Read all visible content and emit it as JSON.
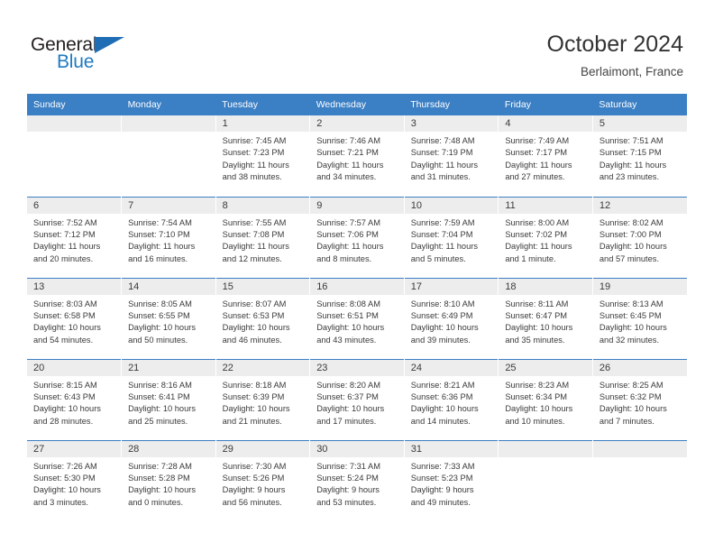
{
  "brand": {
    "name_part1": "General",
    "name_part2": "Blue",
    "triangle_color": "#1f6db5",
    "blue_color": "#1f7ac0"
  },
  "header": {
    "title": "October 2024",
    "location": "Berlaimont, France"
  },
  "theme": {
    "header_blue": "#3b7fc4",
    "daynum_gray": "#ededed",
    "text_color": "#3a3a3a"
  },
  "weekdays": [
    "Sunday",
    "Monday",
    "Tuesday",
    "Wednesday",
    "Thursday",
    "Friday",
    "Saturday"
  ],
  "weeks": [
    [
      {
        "day": "",
        "lines": []
      },
      {
        "day": "",
        "lines": []
      },
      {
        "day": "1",
        "lines": [
          "Sunrise: 7:45 AM",
          "Sunset: 7:23 PM",
          "Daylight: 11 hours",
          "and 38 minutes."
        ]
      },
      {
        "day": "2",
        "lines": [
          "Sunrise: 7:46 AM",
          "Sunset: 7:21 PM",
          "Daylight: 11 hours",
          "and 34 minutes."
        ]
      },
      {
        "day": "3",
        "lines": [
          "Sunrise: 7:48 AM",
          "Sunset: 7:19 PM",
          "Daylight: 11 hours",
          "and 31 minutes."
        ]
      },
      {
        "day": "4",
        "lines": [
          "Sunrise: 7:49 AM",
          "Sunset: 7:17 PM",
          "Daylight: 11 hours",
          "and 27 minutes."
        ]
      },
      {
        "day": "5",
        "lines": [
          "Sunrise: 7:51 AM",
          "Sunset: 7:15 PM",
          "Daylight: 11 hours",
          "and 23 minutes."
        ]
      }
    ],
    [
      {
        "day": "6",
        "lines": [
          "Sunrise: 7:52 AM",
          "Sunset: 7:12 PM",
          "Daylight: 11 hours",
          "and 20 minutes."
        ]
      },
      {
        "day": "7",
        "lines": [
          "Sunrise: 7:54 AM",
          "Sunset: 7:10 PM",
          "Daylight: 11 hours",
          "and 16 minutes."
        ]
      },
      {
        "day": "8",
        "lines": [
          "Sunrise: 7:55 AM",
          "Sunset: 7:08 PM",
          "Daylight: 11 hours",
          "and 12 minutes."
        ]
      },
      {
        "day": "9",
        "lines": [
          "Sunrise: 7:57 AM",
          "Sunset: 7:06 PM",
          "Daylight: 11 hours",
          "and 8 minutes."
        ]
      },
      {
        "day": "10",
        "lines": [
          "Sunrise: 7:59 AM",
          "Sunset: 7:04 PM",
          "Daylight: 11 hours",
          "and 5 minutes."
        ]
      },
      {
        "day": "11",
        "lines": [
          "Sunrise: 8:00 AM",
          "Sunset: 7:02 PM",
          "Daylight: 11 hours",
          "and 1 minute."
        ]
      },
      {
        "day": "12",
        "lines": [
          "Sunrise: 8:02 AM",
          "Sunset: 7:00 PM",
          "Daylight: 10 hours",
          "and 57 minutes."
        ]
      }
    ],
    [
      {
        "day": "13",
        "lines": [
          "Sunrise: 8:03 AM",
          "Sunset: 6:58 PM",
          "Daylight: 10 hours",
          "and 54 minutes."
        ]
      },
      {
        "day": "14",
        "lines": [
          "Sunrise: 8:05 AM",
          "Sunset: 6:55 PM",
          "Daylight: 10 hours",
          "and 50 minutes."
        ]
      },
      {
        "day": "15",
        "lines": [
          "Sunrise: 8:07 AM",
          "Sunset: 6:53 PM",
          "Daylight: 10 hours",
          "and 46 minutes."
        ]
      },
      {
        "day": "16",
        "lines": [
          "Sunrise: 8:08 AM",
          "Sunset: 6:51 PM",
          "Daylight: 10 hours",
          "and 43 minutes."
        ]
      },
      {
        "day": "17",
        "lines": [
          "Sunrise: 8:10 AM",
          "Sunset: 6:49 PM",
          "Daylight: 10 hours",
          "and 39 minutes."
        ]
      },
      {
        "day": "18",
        "lines": [
          "Sunrise: 8:11 AM",
          "Sunset: 6:47 PM",
          "Daylight: 10 hours",
          "and 35 minutes."
        ]
      },
      {
        "day": "19",
        "lines": [
          "Sunrise: 8:13 AM",
          "Sunset: 6:45 PM",
          "Daylight: 10 hours",
          "and 32 minutes."
        ]
      }
    ],
    [
      {
        "day": "20",
        "lines": [
          "Sunrise: 8:15 AM",
          "Sunset: 6:43 PM",
          "Daylight: 10 hours",
          "and 28 minutes."
        ]
      },
      {
        "day": "21",
        "lines": [
          "Sunrise: 8:16 AM",
          "Sunset: 6:41 PM",
          "Daylight: 10 hours",
          "and 25 minutes."
        ]
      },
      {
        "day": "22",
        "lines": [
          "Sunrise: 8:18 AM",
          "Sunset: 6:39 PM",
          "Daylight: 10 hours",
          "and 21 minutes."
        ]
      },
      {
        "day": "23",
        "lines": [
          "Sunrise: 8:20 AM",
          "Sunset: 6:37 PM",
          "Daylight: 10 hours",
          "and 17 minutes."
        ]
      },
      {
        "day": "24",
        "lines": [
          "Sunrise: 8:21 AM",
          "Sunset: 6:36 PM",
          "Daylight: 10 hours",
          "and 14 minutes."
        ]
      },
      {
        "day": "25",
        "lines": [
          "Sunrise: 8:23 AM",
          "Sunset: 6:34 PM",
          "Daylight: 10 hours",
          "and 10 minutes."
        ]
      },
      {
        "day": "26",
        "lines": [
          "Sunrise: 8:25 AM",
          "Sunset: 6:32 PM",
          "Daylight: 10 hours",
          "and 7 minutes."
        ]
      }
    ],
    [
      {
        "day": "27",
        "lines": [
          "Sunrise: 7:26 AM",
          "Sunset: 5:30 PM",
          "Daylight: 10 hours",
          "and 3 minutes."
        ]
      },
      {
        "day": "28",
        "lines": [
          "Sunrise: 7:28 AM",
          "Sunset: 5:28 PM",
          "Daylight: 10 hours",
          "and 0 minutes."
        ]
      },
      {
        "day": "29",
        "lines": [
          "Sunrise: 7:30 AM",
          "Sunset: 5:26 PM",
          "Daylight: 9 hours",
          "and 56 minutes."
        ]
      },
      {
        "day": "30",
        "lines": [
          "Sunrise: 7:31 AM",
          "Sunset: 5:24 PM",
          "Daylight: 9 hours",
          "and 53 minutes."
        ]
      },
      {
        "day": "31",
        "lines": [
          "Sunrise: 7:33 AM",
          "Sunset: 5:23 PM",
          "Daylight: 9 hours",
          "and 49 minutes."
        ]
      },
      {
        "day": "",
        "lines": []
      },
      {
        "day": "",
        "lines": []
      }
    ]
  ]
}
